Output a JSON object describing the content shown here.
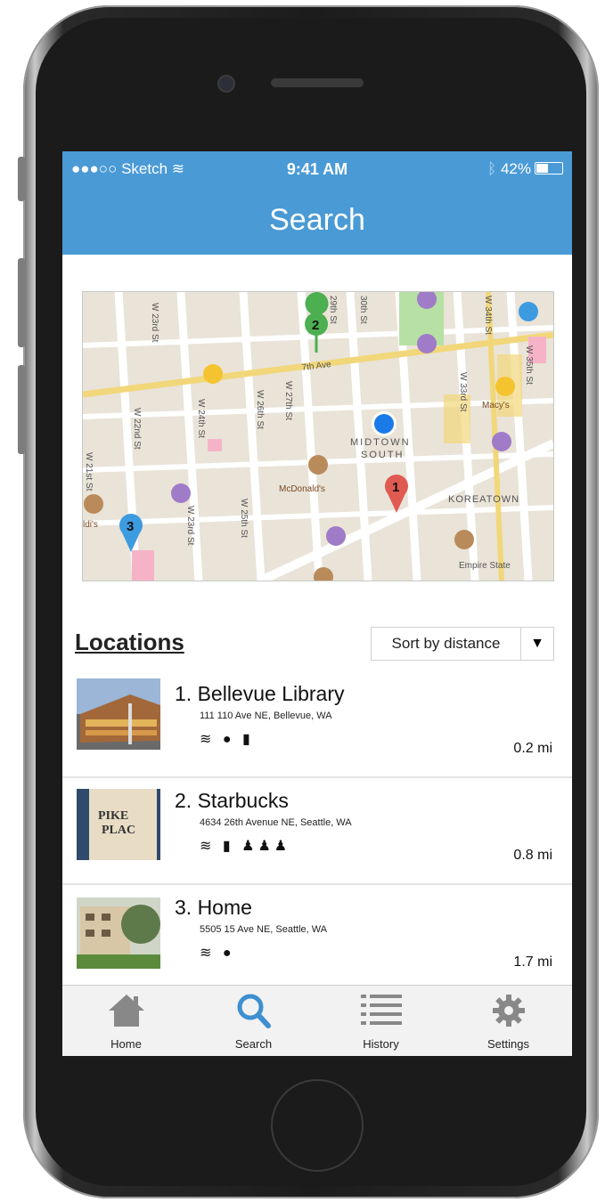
{
  "status_bar": {
    "carrier": "●●●○○ Sketch",
    "time": "9:41 AM",
    "battery": "42%"
  },
  "header": {
    "title": "Search"
  },
  "map": {
    "labels": [
      "7th Ave",
      "W 23rd St",
      "W 21st St",
      "W 22nd St",
      "W 24th St",
      "W 26th St",
      "W 27th St",
      "W 25th St",
      "W 23rd St",
      "W 34th St",
      "W 33rd St",
      "W 35th St",
      "29th St",
      "30th St",
      "MIDTOWN",
      "SOUTH",
      "KOREATOWN",
      "McDonald's",
      "Macy's",
      "Empire State",
      "Aldi's"
    ],
    "pins": [
      {
        "label": "1",
        "color": "#e05a52"
      },
      {
        "label": "2",
        "color": "#4caf50"
      },
      {
        "label": "3",
        "color": "#3d9be0"
      }
    ]
  },
  "locations_header": "Locations",
  "sort": {
    "label": "Sort by distance",
    "arrow": "▼"
  },
  "locations": [
    {
      "name": "1. Bellevue Library",
      "address": "111 110 Ave NE, Bellevue, WA",
      "amenities": "wifi-icon apple-icon drink-icon",
      "amenity_glyphs": "≋ ● ▮",
      "distance": "0.2 mi"
    },
    {
      "name": "2. Starbucks",
      "address": "4634 26th Avenue NE, Seattle, WA",
      "amenities": "wifi-icon drink-icon people-icon",
      "amenity_glyphs": "≋ ▮ ♟♟♟",
      "distance": "0.8 mi"
    },
    {
      "name": "3. Home",
      "address": "5505 15 Ave NE, Seattle, WA",
      "amenities": "wifi-icon apple-icon",
      "amenity_glyphs": "≋ ●",
      "distance": "1.7 mi"
    }
  ],
  "tabs": [
    {
      "label": "Home",
      "icon": "home-icon"
    },
    {
      "label": "Search",
      "icon": "search-icon"
    },
    {
      "label": "History",
      "icon": "list-icon"
    },
    {
      "label": "Settings",
      "icon": "gear-icon"
    }
  ],
  "colors": {
    "accent": "#4a9ad6",
    "active_tab": "#3d8fd0",
    "inactive_tab": "#888888"
  }
}
